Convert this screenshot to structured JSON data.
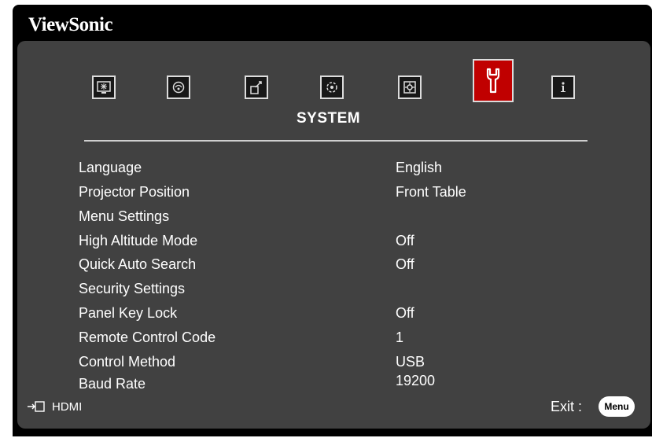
{
  "brand": "ViewSonic",
  "menu_icons": [
    {
      "name": "display-icon",
      "active": false
    },
    {
      "name": "image-icon",
      "active": false
    },
    {
      "name": "power-management-icon",
      "active": false
    },
    {
      "name": "basic-icon",
      "active": false
    },
    {
      "name": "advanced-icon",
      "active": false
    },
    {
      "name": "system-wrench-icon",
      "active": true
    },
    {
      "name": "information-icon",
      "active": false
    }
  ],
  "section_title": "SYSTEM",
  "rows": [
    {
      "label": "Language",
      "value": "English"
    },
    {
      "label": "Projector Position",
      "value": "Front Table"
    },
    {
      "label": "Menu Settings",
      "value": ""
    },
    {
      "label": "High Altitude Mode",
      "value": "Off"
    },
    {
      "label": "Quick Auto Search",
      "value": "Off"
    },
    {
      "label": "Security Settings",
      "value": ""
    },
    {
      "label": "Panel Key Lock",
      "value": "Off"
    },
    {
      "label": "Remote Control Code",
      "value": "1"
    },
    {
      "label": "Control Method",
      "value": "USB"
    },
    {
      "label": "Baud Rate",
      "value": "19200"
    }
  ],
  "footer": {
    "source_icon": "input-source-icon",
    "source": "HDMI",
    "exit_label": "Exit :",
    "menu_button": "Menu"
  },
  "colors": {
    "panel": "#414141",
    "active_tab": "#c00000",
    "text": "#ffffff"
  }
}
